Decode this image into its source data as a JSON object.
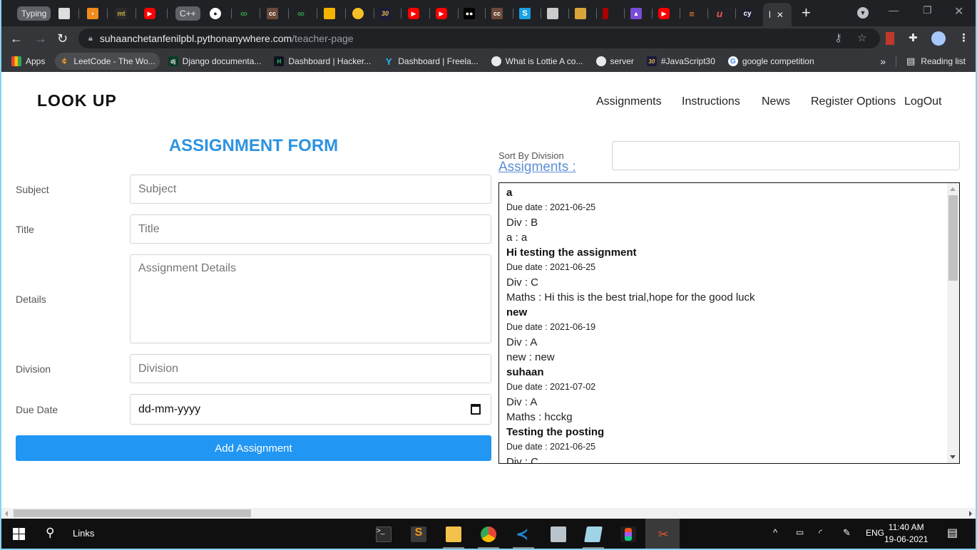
{
  "browser": {
    "tabs": [
      {
        "label": "Typing",
        "kind": "pill"
      },
      {
        "label": "",
        "icon": "doc-icon"
      },
      {
        "label": "",
        "icon": "orange-app-icon"
      },
      {
        "label": "mt",
        "icon": "mt-icon"
      },
      {
        "label": "",
        "icon": "youtube-icon"
      },
      {
        "label": "C++",
        "kind": "pill"
      },
      {
        "label": "",
        "icon": "globe-icon"
      },
      {
        "label": "",
        "icon": "geeksforgeeks-icon"
      },
      {
        "label": "cc",
        "icon": "codechef-icon"
      },
      {
        "label": "",
        "icon": "geeksforgeeks-icon"
      },
      {
        "label": "",
        "icon": "classroom-icon"
      },
      {
        "label": "",
        "icon": "sun-icon"
      },
      {
        "label": "30",
        "icon": "javascript30-icon"
      },
      {
        "label": "",
        "icon": "youtube-icon"
      },
      {
        "label": "",
        "icon": "youtube-icon"
      },
      {
        "label": "",
        "icon": "medium-icon"
      },
      {
        "label": "cc",
        "icon": "codechef-icon"
      },
      {
        "label": "S",
        "icon": "s-app-icon"
      },
      {
        "label": "",
        "icon": "avatar-icon"
      },
      {
        "label": "",
        "icon": "bricks-icon"
      },
      {
        "label": "",
        "icon": "red-app-icon"
      },
      {
        "label": "",
        "icon": "rocket-icon"
      },
      {
        "label": "",
        "icon": "youtube-icon"
      },
      {
        "label": "",
        "icon": "stackoverflow-icon"
      },
      {
        "label": "u",
        "icon": "udemy-icon"
      },
      {
        "label": "cy",
        "icon": "cy-icon"
      }
    ],
    "active_tab": {
      "label": "l",
      "close": "✕"
    },
    "new_tab": "+",
    "url_host": "suhaanchetanfenilpbl.pythonanywhere.com",
    "url_path": "/teacher-page",
    "bookmarks": [
      {
        "label": "Apps",
        "icon": "apps-grid-icon"
      },
      {
        "label": "LeetCode - The Wo...",
        "icon": "leetcode-icon"
      },
      {
        "label": "Django documenta...",
        "icon": "django-icon"
      },
      {
        "label": "Dashboard | Hacker...",
        "icon": "hackerrank-icon"
      },
      {
        "label": "Dashboard | Freela...",
        "icon": "freelancer-icon"
      },
      {
        "label": "What is Lottie A co...",
        "icon": "globe-icon"
      },
      {
        "label": "server",
        "icon": "globe-icon"
      },
      {
        "label": "#JavaScript30",
        "icon": "javascript30-icon"
      },
      {
        "label": "google competition",
        "icon": "google-icon"
      }
    ],
    "bookmarks_overflow": "»",
    "reading_list": "Reading list"
  },
  "site": {
    "brand": "LOOK UP",
    "nav": [
      "Assignments",
      "Instructions",
      "News",
      "Register Options",
      "LogOut"
    ]
  },
  "form": {
    "title": "ASSIGNMENT FORM",
    "fields": [
      {
        "label": "Subject",
        "placeholder": "Subject"
      },
      {
        "label": "Title",
        "placeholder": "Title"
      },
      {
        "label": "Details",
        "placeholder": "Assignment Details"
      },
      {
        "label": "Division",
        "placeholder": "Division"
      },
      {
        "label": "Due Date",
        "placeholder": "dd-mm-yyyy"
      }
    ],
    "submit": "Add Assignment"
  },
  "list": {
    "sort_label": "Sort By Division",
    "sort_value": "",
    "heading": "Assigments :",
    "items": [
      {
        "title": "a",
        "due": "Due date : 2021-06-25",
        "div": "Div : B",
        "body": "a : a"
      },
      {
        "title": "Hi testing the assignment",
        "due": "Due date : 2021-06-25",
        "div": "Div : C",
        "body": "Maths : Hi this is the best trial,hope for the good luck"
      },
      {
        "title": "new",
        "due": "Due date : 2021-06-19",
        "div": "Div : A",
        "body": "new : new"
      },
      {
        "title": "suhaan",
        "due": "Due date : 2021-07-02",
        "div": "Div : A",
        "body": "Maths : hcckg"
      },
      {
        "title": "Testing the posting",
        "due": "Due date : 2021-06-25",
        "div": "Div : C",
        "body": ""
      }
    ]
  },
  "taskbar": {
    "search_label": "Links",
    "language": "ENG",
    "time": "11:40 AM",
    "date": "19-06-2021"
  },
  "colors": {
    "accent": "#2196f3",
    "title_blue": "#2d93e0",
    "link_blue": "#5b8fd6"
  }
}
